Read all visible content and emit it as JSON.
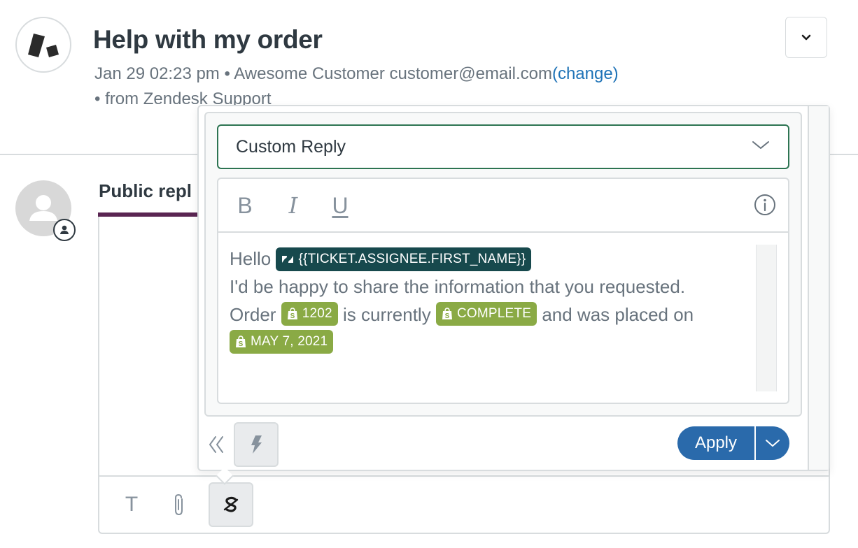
{
  "header": {
    "title": "Help with my order",
    "timestamp": "Jan 29 02:23 pm",
    "separator": " • ",
    "requester_name": "Awesome Customer",
    "requester_email": "customer@email.com",
    "change_link": "(change)",
    "source": "• from Zendesk Support",
    "menu_icon": "chevron-down-icon"
  },
  "reply": {
    "tab_label": "Public repl",
    "tab_accent_color": "#5a2552",
    "toolbar": {
      "text_label": "T",
      "icons": [
        "text-format-icon",
        "paperclip-icon",
        "app-icon"
      ]
    }
  },
  "popover": {
    "macro_select": {
      "value": "Custom Reply",
      "border_color": "#2d7452"
    },
    "format_toolbar": {
      "bold": "B",
      "italic": "I",
      "underline": "U",
      "info_icon": "info-icon"
    },
    "body": {
      "greeting": "Hello",
      "assignee_placeholder": "{{TICKET.ASSIGNEE.FIRST_NAME}}",
      "line2": "I'd be happy to share the information that you requested.",
      "order_prefix": "Order",
      "order_number": "1202",
      "status_prefix": "is currently",
      "order_status": "COMPLETE",
      "date_prefix": "and was placed on",
      "order_date": "MAY 7, 2021"
    },
    "colors": {
      "zendesk_pill": "#17494d",
      "shopify_pill": "#8aaa45",
      "apply_button": "#2a6aab"
    },
    "footer": {
      "collapse_icon": "double-chevron-left-icon",
      "macros_icon": "lightning-icon",
      "apply_label": "Apply",
      "apply_menu_icon": "chevron-down-icon"
    }
  }
}
